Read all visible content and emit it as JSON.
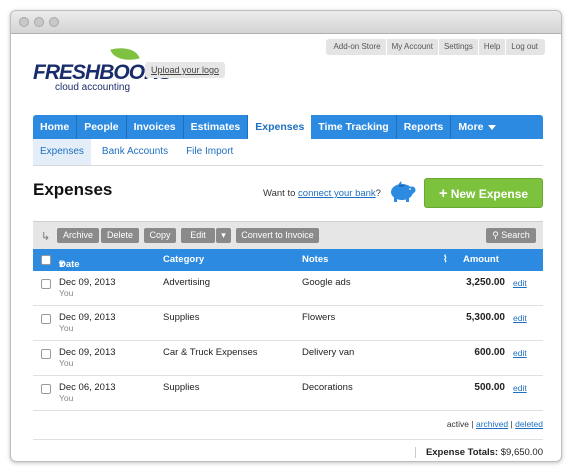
{
  "toplinks": [
    "Add-on Store",
    "My Account",
    "Settings",
    "Help",
    "Log out"
  ],
  "logo": {
    "word_a": "FRESH",
    "word_b": "BOOKS",
    "subtitle": "cloud accounting"
  },
  "upload_logo": "Upload your logo",
  "mainnav": [
    "Home",
    "People",
    "Invoices",
    "Estimates",
    "Expenses",
    "Time Tracking",
    "Reports",
    "More"
  ],
  "mainnav_active": "Expenses",
  "subnav": [
    "Expenses",
    "Bank Accounts",
    "File Import"
  ],
  "page_title": "Expenses",
  "connect": {
    "prefix": "Want to ",
    "link": "connect your bank",
    "suffix": "?"
  },
  "new_expense": "New Expense",
  "toolbar": {
    "archive": "Archive",
    "delete": "Delete",
    "copy": "Copy",
    "edit": "Edit",
    "convert": "Convert to Invoice",
    "search": "Search"
  },
  "table": {
    "headers": {
      "date": "Date",
      "category": "Category",
      "notes": "Notes",
      "amount": "Amount"
    },
    "rows": [
      {
        "date": "Dec 09, 2013",
        "by": "You",
        "category": "Advertising",
        "notes": "Google ads",
        "amount": "3,250.00",
        "edit": "edit"
      },
      {
        "date": "Dec 09, 2013",
        "by": "You",
        "category": "Supplies",
        "notes": "Flowers",
        "amount": "5,300.00",
        "edit": "edit"
      },
      {
        "date": "Dec 09, 2013",
        "by": "You",
        "category": "Car & Truck Expenses",
        "notes": "Delivery van",
        "amount": "600.00",
        "edit": "edit"
      },
      {
        "date": "Dec 06, 2013",
        "by": "You",
        "category": "Supplies",
        "notes": "Decorations",
        "amount": "500.00",
        "edit": "edit"
      }
    ]
  },
  "filters": {
    "active": "active",
    "archived": "archived",
    "deleted": "deleted",
    "sep": "|"
  },
  "totals": {
    "label": "Expense Totals:",
    "value": "$9,650.00"
  },
  "colors": {
    "nav_blue": "#2c8ae0",
    "green_button": "#7dc23d",
    "link_blue": "#1e6fc1"
  }
}
